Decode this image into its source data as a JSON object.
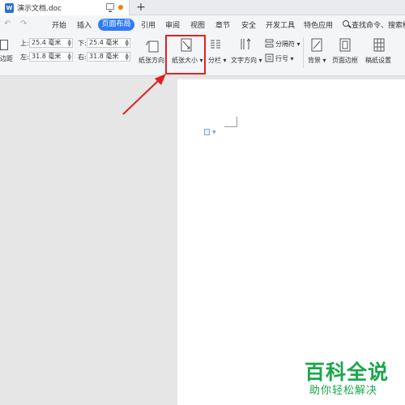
{
  "titlebar": {
    "doc_icon": "W",
    "doc_title": "演示文档.doc",
    "new_tab": "+"
  },
  "menubar": {
    "undo": "↶",
    "redo": "↷",
    "items": [
      "开始",
      "插入",
      "引用",
      "审阅",
      "视图",
      "章节",
      "安全",
      "开发工具",
      "特色应用"
    ],
    "active_tab": "页面布局",
    "search": "查找命令、搜索模板"
  },
  "ribbon": {
    "margins_label": "边距",
    "top_label": "上:",
    "top_value": "25.4 毫米",
    "bottom_label": "下:",
    "bottom_value": "25.4 毫米",
    "left_label": "左:",
    "left_value": "31.8 毫米",
    "right_label": "右:",
    "right_value": "31.8 毫米",
    "orientation": "纸张方向",
    "paper_size": "纸张大小",
    "columns": "分栏",
    "text_direction": "文字方向",
    "separator": "分隔符",
    "line_numbers": "行号",
    "background": "背景",
    "page_border": "页面边框",
    "manuscript": "稿纸设置"
  },
  "colors": {
    "accent": "#2f7cf6",
    "highlight_box": "#e02020",
    "watermark": "#17a84a",
    "tab_dot": "#ff7a00"
  },
  "watermark": {
    "title": "百科全说",
    "subtitle": "助你轻松解决"
  }
}
